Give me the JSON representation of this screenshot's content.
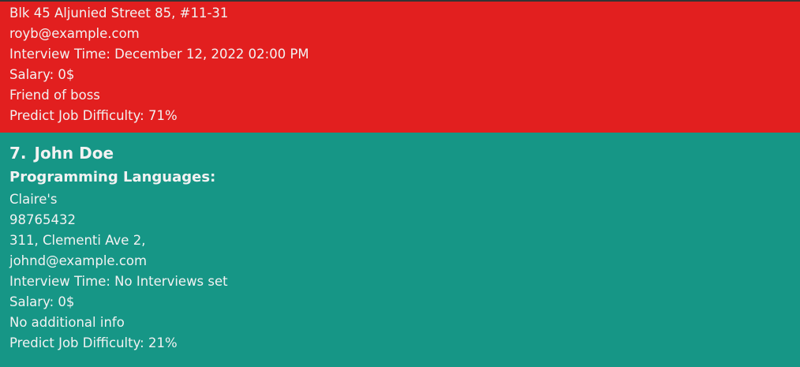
{
  "colors": {
    "card_alert": "#e21f1f",
    "card_normal": "#169686"
  },
  "cards": [
    {
      "lines": [
        "Blk 45 Aljunied Street 85, #11-31",
        "royb@example.com",
        "Interview Time: December 12, 2022 02:00 PM",
        "Salary: 0$",
        "Friend of boss",
        "Predict Job Difficulty: 71%"
      ]
    },
    {
      "index": "7.",
      "name": "John Doe",
      "section": "Programming Languages:",
      "lines": [
        "Claire's",
        "98765432",
        "311, Clementi Ave 2,",
        "johnd@example.com",
        "Interview Time: No Interviews set",
        "Salary: 0$",
        "No additional info",
        "Predict Job Difficulty: 21%"
      ]
    }
  ]
}
